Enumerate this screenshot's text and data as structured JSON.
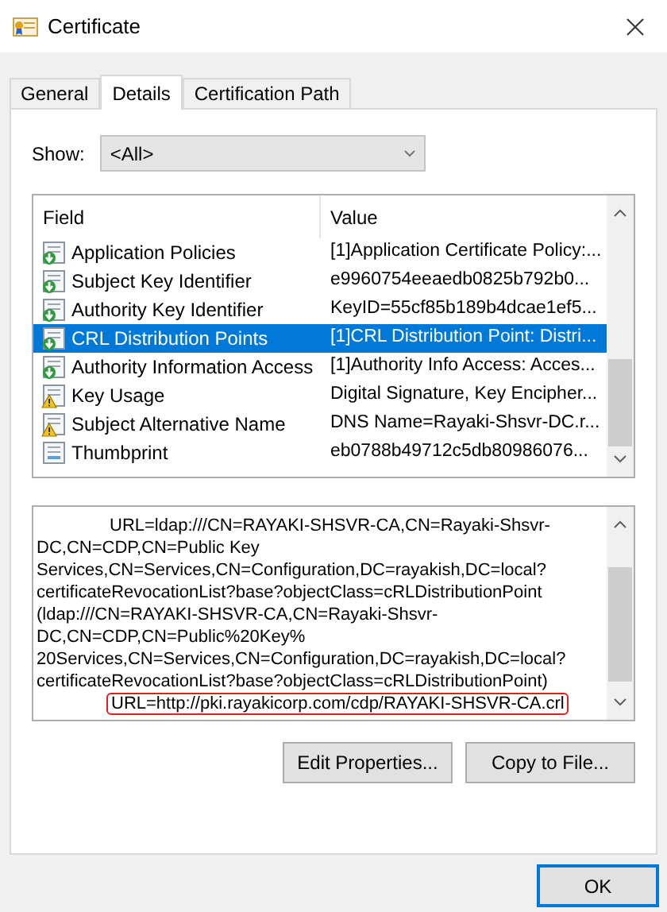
{
  "window": {
    "title": "Certificate"
  },
  "tabs": [
    {
      "label": "General",
      "selected": false
    },
    {
      "label": "Details",
      "selected": true
    },
    {
      "label": "Certification Path",
      "selected": false
    }
  ],
  "show": {
    "label": "Show:",
    "value": "<All>"
  },
  "fields": {
    "columns": [
      "Field",
      "Value"
    ],
    "rows": [
      {
        "kind": "extension",
        "field": "Application Policies",
        "value": "[1]Application Certificate Policy:...",
        "selected": false
      },
      {
        "kind": "extension",
        "field": "Subject Key Identifier",
        "value": "e9960754eeaedb0825b792b0...",
        "selected": false
      },
      {
        "kind": "extension",
        "field": "Authority Key Identifier",
        "value": "KeyID=55cf85b189b4dcae1ef5...",
        "selected": false
      },
      {
        "kind": "extension",
        "field": "CRL Distribution Points",
        "value": "[1]CRL Distribution Point: Distri...",
        "selected": true
      },
      {
        "kind": "extension",
        "field": "Authority Information Access",
        "value": "[1]Authority Info Access: Acces...",
        "selected": false
      },
      {
        "kind": "critical",
        "field": "Key Usage",
        "value": "Digital Signature, Key Encipher...",
        "selected": false
      },
      {
        "kind": "critical",
        "field": "Subject Alternative Name",
        "value": "DNS Name=Rayaki-Shsvr-DC.r...",
        "selected": false
      },
      {
        "kind": "plain",
        "field": "Thumbprint",
        "value": "eb0788b49712c5db80986076...",
        "selected": false
      }
    ]
  },
  "detail": {
    "lines": [
      {
        "kind": "url",
        "text": "URL=ldap:///CN=RAYAKI-SHSVR-CA,CN=Rayaki-Shsvr-",
        "highlighted": false
      },
      {
        "kind": "wrap",
        "text": "DC,CN=CDP,CN=Public Key",
        "highlighted": false
      },
      {
        "kind": "wrap",
        "text": "Services,CN=Services,CN=Configuration,DC=rayakish,DC=local?",
        "highlighted": false
      },
      {
        "kind": "wrap",
        "text": "certificateRevocationList?base?objectClass=cRLDistributionPoint",
        "highlighted": false
      },
      {
        "kind": "wrap",
        "text": "(ldap:///CN=RAYAKI-SHSVR-CA,CN=Rayaki-Shsvr-",
        "highlighted": false
      },
      {
        "kind": "wrap",
        "text": "DC,CN=CDP,CN=Public%20Key%",
        "highlighted": false
      },
      {
        "kind": "wrap",
        "text": "20Services,CN=Services,CN=Configuration,DC=rayakish,DC=local?",
        "highlighted": false
      },
      {
        "kind": "wrap",
        "text": "certificateRevocationList?base?objectClass=cRLDistributionPoint)",
        "highlighted": false
      },
      {
        "kind": "url",
        "text": "URL=http://pki.rayakicorp.com/cdp/RAYAKI-SHSVR-CA.crl",
        "highlighted": true
      }
    ]
  },
  "buttons": [
    "Edit Properties...",
    "Copy to File..."
  ],
  "footer_buttons": [
    "OK"
  ]
}
